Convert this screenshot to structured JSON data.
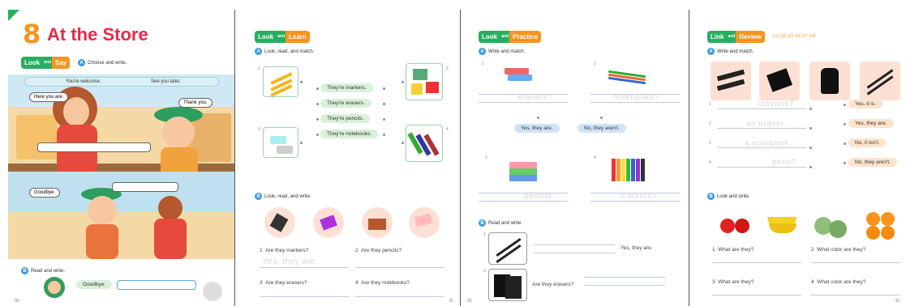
{
  "page1": {
    "unit_number": "8",
    "title": "At the Store",
    "header": {
      "left": "Look",
      "mid": "and",
      "right": "Say"
    },
    "section_a": {
      "badge": "A",
      "text": "Choose and write."
    },
    "word_bank": [
      "You're welcome.",
      "See you later."
    ],
    "bubbles": {
      "here": "Here you are.",
      "thanks": "Thank you.",
      "goodbye": "Goodbye."
    },
    "section_b": {
      "badge": "B",
      "text": "Read and write."
    },
    "bottom_bubble": "Goodbye.",
    "page_number": "30"
  },
  "page2": {
    "header": {
      "left": "Look",
      "mid": "and",
      "right": "Learn"
    },
    "section_a": {
      "badge": "A",
      "text": "Look, read, and match."
    },
    "phrases": [
      "They're markers.",
      "They're erasers.",
      "They're pencils.",
      "They're notebooks."
    ],
    "item_numbers": [
      "1",
      "2",
      "3",
      "4"
    ],
    "section_b": {
      "badge": "B",
      "text": "Look, read, and write."
    },
    "questions": [
      "Are they markers?",
      "Are they pencils?",
      "Are they erasers?",
      "Are they notebooks?"
    ],
    "question_numbers": [
      "1",
      "2",
      "3",
      "4"
    ],
    "example_answer": "Yes, they are.",
    "page_number": "31"
  },
  "page3": {
    "header": {
      "left": "Look",
      "mid": "and",
      "right": "Practice"
    },
    "section_a": {
      "badge": "A",
      "text": "Write and match."
    },
    "traces": [
      "erasers?",
      "notebooks?",
      "pencils?",
      "markers?"
    ],
    "item_numbers": [
      "1",
      "2",
      "3",
      "4"
    ],
    "answers": [
      "Yes, they are.",
      "No, they aren't."
    ],
    "section_b": {
      "badge": "B",
      "text": "Read and write."
    },
    "b_answer": "Yes, they are.",
    "b_question": "Are they erasers?",
    "b_numbers": [
      "1",
      "2"
    ],
    "page_number": "32"
  },
  "page4": {
    "header": {
      "left": "Link",
      "mid": "and",
      "right": "Review"
    },
    "header_units": "U1, U2, U3, U4, U7, U8",
    "section_a": {
      "badge": "A",
      "text": "Write and match."
    },
    "traces": [
      "crayons?",
      "an eraser.",
      "a notebook.",
      "pens?"
    ],
    "item_numbers": [
      "1",
      "2",
      "3",
      "4"
    ],
    "answers": [
      "Yes, it is.",
      "Yes, they are.",
      "No, it isn't.",
      "No, they aren't."
    ],
    "section_b": {
      "badge": "B",
      "text": "Look and write."
    },
    "questions": [
      "What are they?",
      "What color are they?",
      "What are they?",
      "What color are they?"
    ],
    "question_numbers": [
      "1",
      "2",
      "3",
      "4"
    ],
    "page_number": "33"
  },
  "colors": {
    "green": "#27ae60",
    "orange": "#f39c12",
    "unit_red": "#e8294a",
    "unit_orange": "#f7941d",
    "sky": "#cfe8f5",
    "answer_blue": "#cfe4f7",
    "answer_green": "#d9f0d9",
    "peach": "#fde0d4",
    "orange_chip": "#fde3cc"
  }
}
